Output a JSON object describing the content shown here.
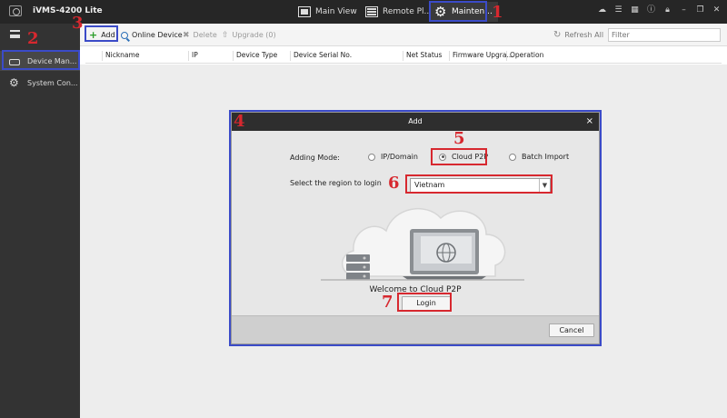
{
  "app": {
    "title": "iVMS-4200 Lite"
  },
  "top_tabs": [
    {
      "label": "Main View"
    },
    {
      "label": "Remote Pl..."
    },
    {
      "label": "Mainten..."
    }
  ],
  "sidebar": {
    "items": [
      {
        "label": "Device Man..."
      },
      {
        "label": "System Con..."
      }
    ]
  },
  "toolbar": {
    "add_label": "Add",
    "online_device_label": "Online Device",
    "delete_label": "Delete",
    "upgrade_label": "Upgrade (0)",
    "refresh_all_label": "Refresh All",
    "filter_placeholder": "Filter"
  },
  "table": {
    "columns": [
      "Nickname",
      "IP",
      "Device Type",
      "Device Serial No.",
      "Net Status",
      "Firmware Upgra...",
      "Operation"
    ]
  },
  "dialog": {
    "title": "Add",
    "close": "×",
    "adding_mode_label": "Adding Mode:",
    "modes": [
      {
        "label": "IP/Domain",
        "selected": false
      },
      {
        "label": "Cloud P2P",
        "selected": true
      },
      {
        "label": "Batch Import",
        "selected": false
      }
    ],
    "region_label": "Select the region to login",
    "region_value": "Vietnam",
    "welcome_text": "Welcome to Cloud P2P",
    "login_label": "Login",
    "cancel_label": "Cancel"
  },
  "annotations": [
    "1",
    "2",
    "3",
    "4",
    "5",
    "6",
    "7"
  ],
  "colors": {
    "annotation_red": "#d7282f",
    "annotation_blue": "#3b4bc8",
    "titlebar": "#262626"
  }
}
